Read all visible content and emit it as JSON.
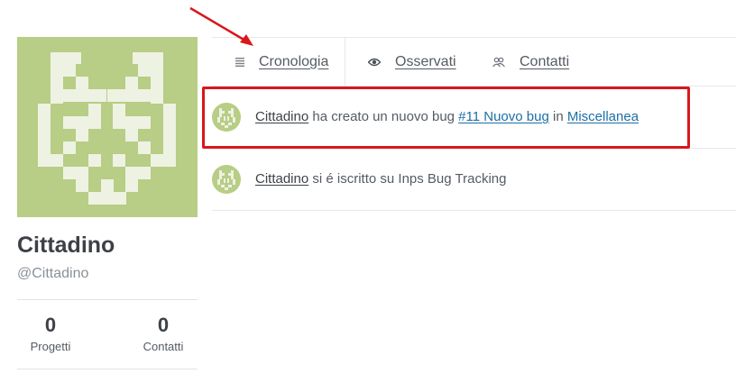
{
  "profile": {
    "name": "Cittadino",
    "handle": "@Cittadino",
    "stats": [
      {
        "value": "0",
        "label": "Progetti"
      },
      {
        "value": "0",
        "label": "Contatti"
      }
    ]
  },
  "tabs": [
    {
      "icon": "list-icon",
      "label": "Cronologia",
      "active": true
    },
    {
      "icon": "eye-icon",
      "label": "Osservati",
      "active": false
    },
    {
      "icon": "users-icon",
      "label": "Contatti",
      "active": false
    }
  ],
  "feed": [
    {
      "user": "Cittadino",
      "action": "ha creato un nuovo bug",
      "target": "#11 Nuovo bug",
      "preposition": "in",
      "project": "Miscellanea"
    },
    {
      "user": "Cittadino",
      "action": "si é iscritto su Inps Bug Tracking"
    }
  ],
  "colors": {
    "avatar_bg": "#b8cd85",
    "avatar_fg": "#eef2e2",
    "annotation": "#d9171b",
    "link": "#1d6fa5"
  }
}
